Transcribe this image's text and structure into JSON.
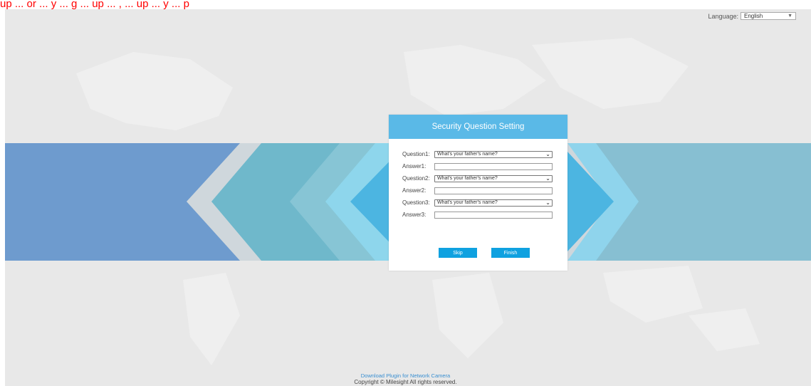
{
  "top_banner_text": "up ... or ... y ... g ... up ... , ... up ... y ... p",
  "language": {
    "label": "Language:",
    "selected": "English"
  },
  "dialog": {
    "title": "Security Question Setting",
    "questions": [
      {
        "label": "Question1:",
        "value": "What's your father's name?",
        "answer_label": "Answer1:"
      },
      {
        "label": "Question2:",
        "value": "What's your father's name?",
        "answer_label": "Answer2:"
      },
      {
        "label": "Question3:",
        "value": "What's your father's name?",
        "answer_label": "Answer3:"
      }
    ],
    "skip_label": "Skip",
    "finish_label": "Finish"
  },
  "footer": {
    "plugin_link": "Download Plugin for Network Camera",
    "copyright": "Copyright © Milesight All rights reserved."
  },
  "colors": {
    "header": "#5ab9e7",
    "button": "#0fa1e0",
    "band_left": "#6e9bce",
    "band_right": "#87bfd2"
  }
}
